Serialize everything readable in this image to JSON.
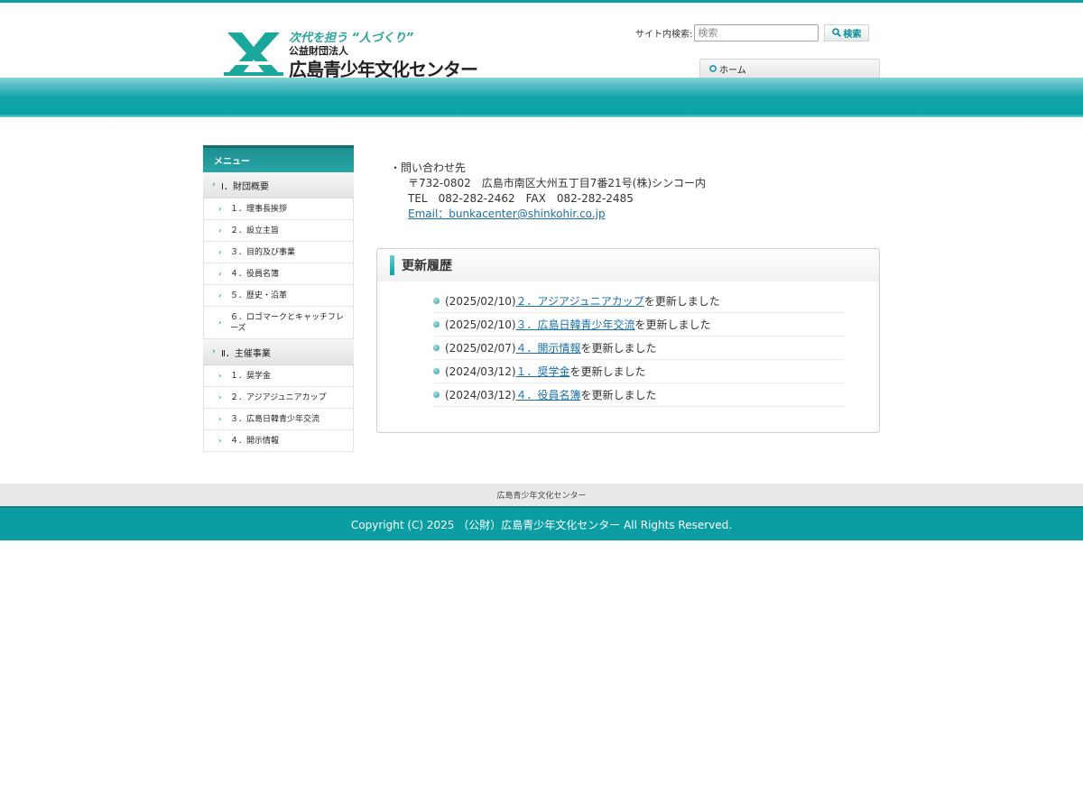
{
  "header": {
    "tagline": "次代を担う “人づくり”",
    "corp_type": "公益財団法人",
    "org_name": "広島青少年文化センター",
    "search_label": "サイト内検索:",
    "search_placeholder": "検索",
    "search_button": "検索",
    "nav_home": "ホーム"
  },
  "sidebar": {
    "title": "メニュー",
    "categories": [
      {
        "label": "Ⅰ．財団概要",
        "items": [
          "１．理事長挨拶",
          "２．設立主旨",
          "３．目的及び事業",
          "４．役員名簿",
          "５．歴史・沿革",
          "６．ロゴマークとキャッチフレーズ"
        ]
      },
      {
        "label": "Ⅱ．主催事業",
        "items": [
          "１．奨学金",
          "２．アジアジュニアカップ",
          "３．広島日韓青少年交流",
          "４．開示情報"
        ]
      }
    ]
  },
  "contact": {
    "heading": "問い合わせ先",
    "address": "〒732-0802　広島市南区大州五丁目7番21号(株)シンコー内",
    "phone": "TEL　082-282-2462　FAX　082-282-2485",
    "email": "Email：bunkacenter@shinkohir.co.jp"
  },
  "updates": {
    "title": "更新履歴",
    "entries": [
      {
        "date": "(2025/02/10)",
        "link": "２．アジアジュニアカップ",
        "suffix": "を更新しました"
      },
      {
        "date": "(2025/02/10)",
        "link": "３．広島日韓青少年交流",
        "suffix": "を更新しました"
      },
      {
        "date": "(2025/02/07)",
        "link": "４．開示情報",
        "suffix": "を更新しました"
      },
      {
        "date": "(2024/03/12)",
        "link": "１．奨学金",
        "suffix": "を更新しました"
      },
      {
        "date": "(2024/03/12)",
        "link": "４．役員名簿",
        "suffix": "を更新しました"
      }
    ]
  },
  "footer": {
    "nav_text": "広島青少年文化センター",
    "copyright": "Copyright (C) 2025 （公財）広島青少年文化センター All Rights Reserved."
  },
  "colors": {
    "accent": "#0ea0a4",
    "link": "#1a6fa8",
    "footer": "#0a9ea3"
  }
}
